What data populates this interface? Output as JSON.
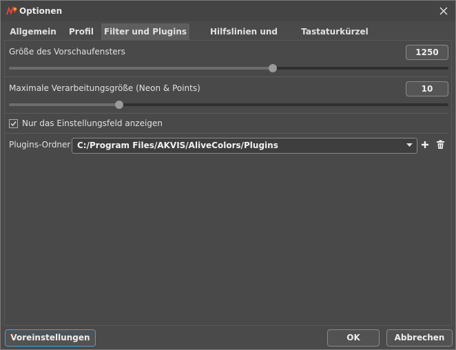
{
  "window": {
    "title": "Optionen"
  },
  "tabs": [
    {
      "label": "Allgemein"
    },
    {
      "label": "Profil"
    },
    {
      "label": "Filter und Plugins"
    },
    {
      "label": "Hilfslinien und Raster"
    },
    {
      "label": "Tastaturkürzel"
    }
  ],
  "settings": {
    "preview_size": {
      "label": "Größe des Vorschaufensters",
      "value": "1250",
      "slider_fraction": 0.6
    },
    "max_processing": {
      "label": "Maximale Verarbeitungsgröße (Neon & Points)",
      "value": "10",
      "slider_fraction": 0.25
    },
    "only_settings_panel": {
      "label": "Nur das Einstellungsfeld anzeigen",
      "checked": true
    },
    "plugins_folder": {
      "label": "Plugins-Ordner",
      "value": "C:/Program Files/AKVIS/AliveColors/Plugins"
    }
  },
  "footer": {
    "defaults_label": "Voreinstellungen",
    "ok_label": "OK",
    "cancel_label": "Abbrechen"
  },
  "colors": {
    "accent": "#4a9fd8",
    "background": "#4a4a4a",
    "app_icon": "#e0473a"
  },
  "icons": [
    "app-logo-icon",
    "close-icon",
    "checkmark-icon",
    "chevron-down-icon",
    "plus-icon",
    "trash-icon"
  ]
}
